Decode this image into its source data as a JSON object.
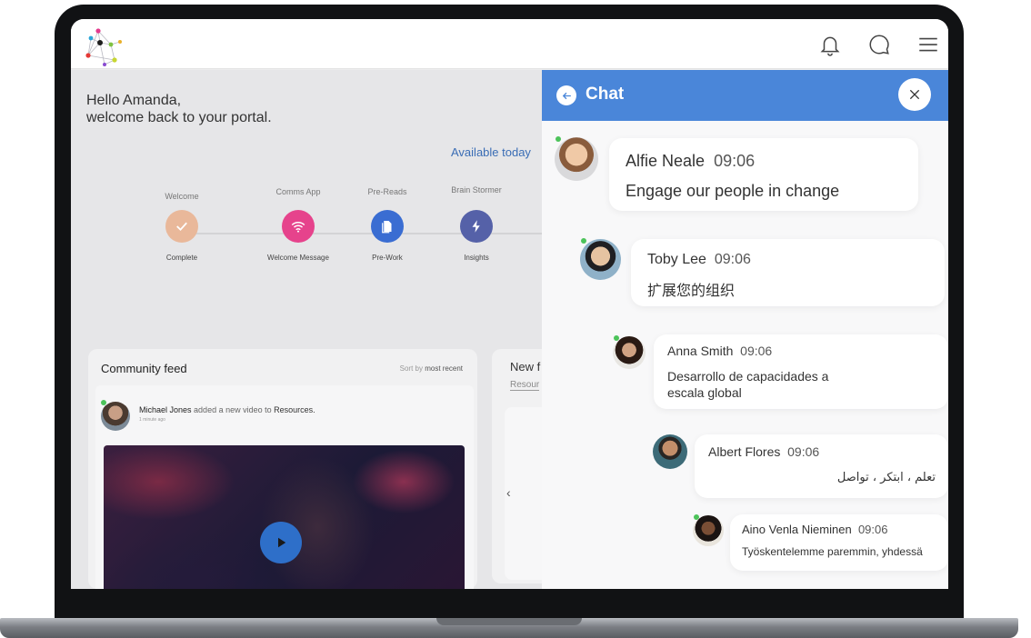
{
  "topbar": {
    "icons": [
      "bell-icon",
      "chat-bubble-icon",
      "hamburger-menu-icon"
    ]
  },
  "greeting": {
    "line1": "Hello Amanda,",
    "line2": "welcome back to your portal."
  },
  "available_today": "Available today",
  "steps": [
    {
      "label": "Welcome",
      "status": "Complete",
      "color": "#e9b89a",
      "icon": "check-icon"
    },
    {
      "label": "Comms App",
      "status": "Welcome Message",
      "color": "#e6438c",
      "icon": "wifi-icon"
    },
    {
      "label": "Pre-Reads",
      "status": "Pre-Work",
      "color": "#3a6dd2",
      "icon": "document-icon"
    },
    {
      "label": "Brain Stormer",
      "status": "Insights",
      "color": "#5561a8",
      "icon": "lightning-icon"
    }
  ],
  "community_feed": {
    "title": "Community feed",
    "sort_prefix": "Sort by",
    "sort_value": "most recent",
    "post": {
      "author": "Michael Jones",
      "action": "added a new video to",
      "target": "Resources.",
      "time": "1 minute ago"
    }
  },
  "new_feed": {
    "title": "New f",
    "subtitle": "Resour"
  },
  "chat": {
    "title": "Chat",
    "header_color": "#4a86d9",
    "messages": [
      {
        "name": "Alfie Neale",
        "time": "09:06",
        "text": "Engage our people in change"
      },
      {
        "name": "Toby Lee",
        "time": "09:06",
        "text": "扩展您的组织"
      },
      {
        "name": "Anna Smith",
        "time": "09:06",
        "text": "Desarrollo de capacidades a escala global"
      },
      {
        "name": "Albert Flores",
        "time": "09:06",
        "text": "تعلم ، ابتكر ، تواصل"
      },
      {
        "name": "Aino Venla Nieminen",
        "time": "09:06",
        "text": "Työskentelemme paremmin, yhdessä"
      }
    ]
  }
}
